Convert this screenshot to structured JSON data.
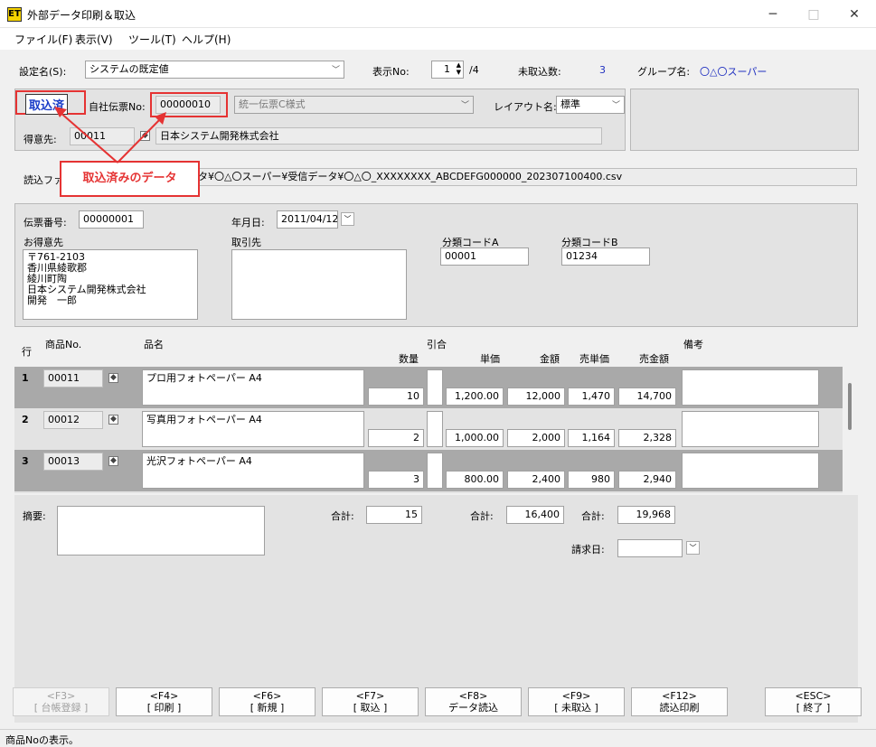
{
  "window": {
    "icon": "ET",
    "title": "外部データ印刷＆取込",
    "minimize": "─",
    "maximize": "□",
    "close": "✕"
  },
  "menu": [
    "ファイル(F)",
    "表示(V)",
    "ツール(T)",
    "ヘルプ(H)"
  ],
  "settings": {
    "name_label": "設定名(S):",
    "name_value": "システムの既定値",
    "display_label": "表示No:",
    "display_value": "1",
    "display_total": "/4",
    "unimported_label": "未取込数:",
    "unimported_value": "3",
    "group_label": "グループ名:",
    "group_value": "〇△〇スーパー"
  },
  "header": {
    "status_badge": "取込済",
    "company_slip_label": "自社伝票No:",
    "company_slip_value": "00000010",
    "slip_type_value": "統一伝票C様式",
    "layout_label": "レイアウト名:",
    "layout_value": "標準",
    "customer_label": "得意先:",
    "customer_code": "00011",
    "customer_name": "日本システム開発株式会社"
  },
  "file": {
    "label": "読込ファ",
    "path_tail": "タ¥〇△〇スーパー¥受信データ¥〇△〇_XXXXXXXX_ABCDEFG000000_202307100400.csv"
  },
  "callout": "取込済みのデータ",
  "slip": {
    "number_label": "伝票番号:",
    "number_value": "00000001",
    "date_label": "年月日:",
    "date_value": "2011/04/12",
    "customer_label": "お得意先",
    "customer_address": "〒761-2103\n香川県綾歌郡\n綾川町陶\n日本システム開発株式会社\n開発　一郎",
    "supplier_label": "取引先",
    "code_a_label": "分類コードA",
    "code_a_value": "00001",
    "code_b_label": "分類コードB",
    "code_b_value": "01234"
  },
  "columns": {
    "row": "行",
    "code": "商品No.",
    "name": "品名",
    "hikiai": "引合",
    "qty": "数量",
    "unit_price": "単価",
    "amount": "金額",
    "sell_price": "売単価",
    "sell_amount": "売金額",
    "remarks": "備考"
  },
  "rows": [
    {
      "no": "1",
      "code": "00011",
      "name": "プロ用フォトペーパー A4",
      "qty": "10",
      "unit_price": "1,200.00",
      "amount": "12,000",
      "sell_price": "1,470",
      "sell_amount": "14,700"
    },
    {
      "no": "2",
      "code": "00012",
      "name": "写真用フォトペーパー A4",
      "qty": "2",
      "unit_price": "1,000.00",
      "amount": "2,000",
      "sell_price": "1,164",
      "sell_amount": "2,328"
    },
    {
      "no": "3",
      "code": "00013",
      "name": "光沢フォトペーパー A4",
      "qty": "3",
      "unit_price": "800.00",
      "amount": "2,400",
      "sell_price": "980",
      "sell_amount": "2,940"
    }
  ],
  "totals": {
    "memo_label": "摘要:",
    "qty_label": "合計:",
    "qty_value": "15",
    "amount_label": "合計:",
    "amount_value": "16,400",
    "sell_label": "合計:",
    "sell_value": "19,968",
    "billing_label": "請求日:"
  },
  "fkeys": [
    {
      "key": "<F3>",
      "label": "[ 台帳登録 ]"
    },
    {
      "key": "<F4>",
      "label": "[ 印刷 ]"
    },
    {
      "key": "<F6>",
      "label": "[ 新規 ]"
    },
    {
      "key": "<F7>",
      "label": "[ 取込 ]"
    },
    {
      "key": "<F8>",
      "label": "データ読込"
    },
    {
      "key": "<F9>",
      "label": "[ 未取込 ]"
    },
    {
      "key": "<F12>",
      "label": "読込印刷"
    },
    {
      "key": "<ESC>",
      "label": "[ 終了 ]"
    }
  ],
  "status_text": "商品Noの表示。"
}
